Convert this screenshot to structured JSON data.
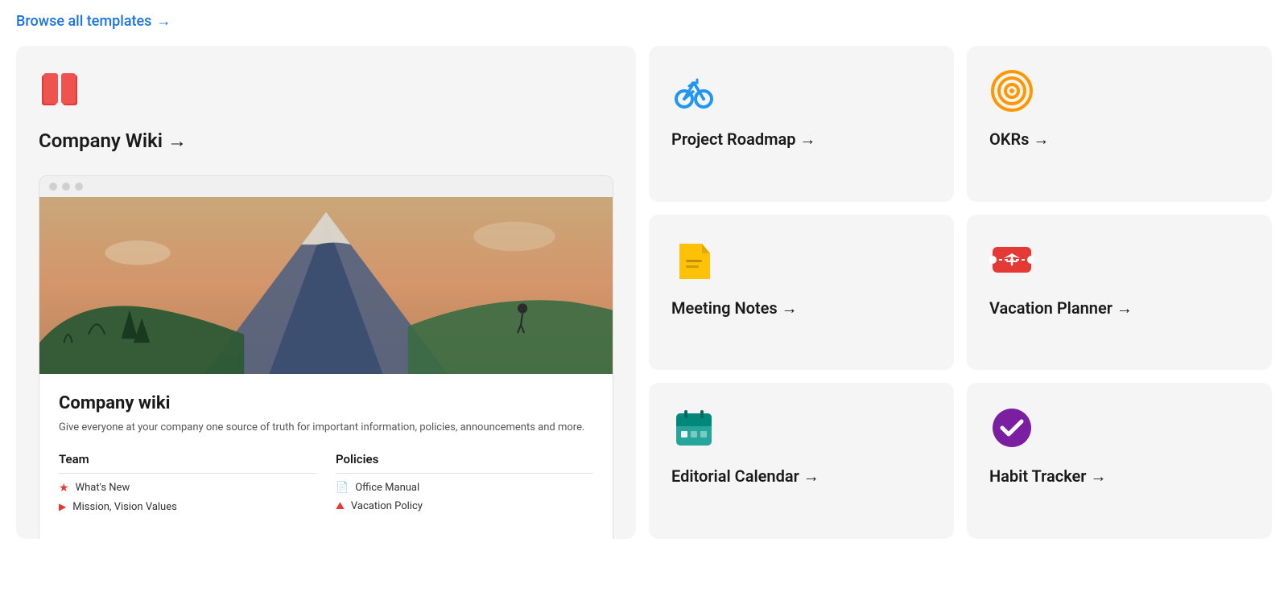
{
  "browse_link": {
    "text": "Browse all templates",
    "arrow": "→"
  },
  "large_card": {
    "icon_alt": "book-icon",
    "title": "Company Wiki →",
    "preview_title": "Company wiki",
    "preview_desc": "Give everyone at your company one source of truth for important information, policies, announcements and more.",
    "col1_title": "Team",
    "col1_items": [
      {
        "icon": "★",
        "text": "What's New",
        "icon_color": "#e53935"
      },
      {
        "icon": "▶",
        "text": "Mission, Vision Values",
        "icon_color": "#e53935"
      }
    ],
    "col2_title": "Policies",
    "col2_items": [
      {
        "icon": "📋",
        "text": "Office Manual"
      },
      {
        "icon": "⛰",
        "text": "Vacation Policy"
      }
    ]
  },
  "small_cards": [
    {
      "id": "project-roadmap",
      "icon_type": "bike",
      "title": "Project Roadmap →"
    },
    {
      "id": "okrs",
      "icon_type": "target",
      "title": "OKRs →"
    },
    {
      "id": "meeting-notes",
      "icon_type": "notes",
      "title": "Meeting Notes →"
    },
    {
      "id": "vacation-planner",
      "icon_type": "plane",
      "title": "Vacation Planner →"
    },
    {
      "id": "editorial-calendar",
      "icon_type": "calendar",
      "title": "Editorial Calendar →"
    },
    {
      "id": "habit-tracker",
      "icon_type": "check",
      "title": "Habit Tracker →"
    }
  ]
}
